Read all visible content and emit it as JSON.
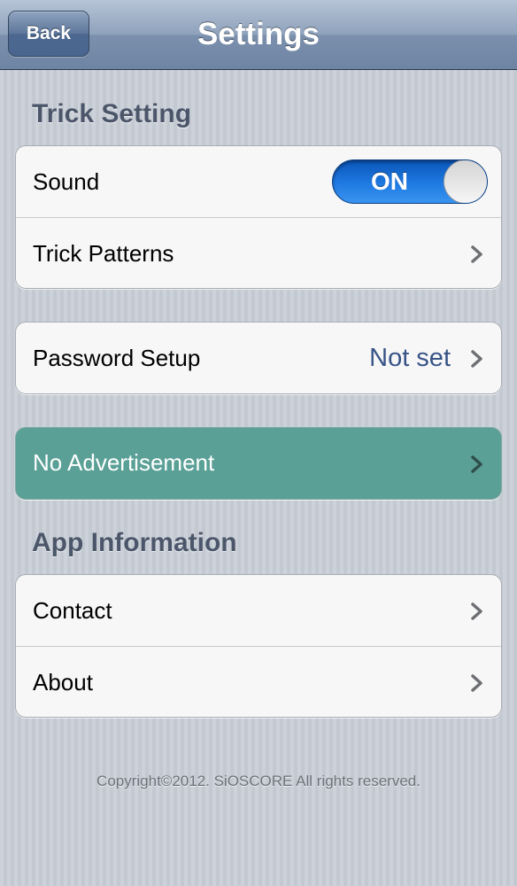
{
  "navbar": {
    "back_label": "Back",
    "title": "Settings"
  },
  "sections": {
    "trick": {
      "header": "Trick Setting",
      "sound": {
        "label": "Sound",
        "toggle_state": "ON"
      },
      "patterns": {
        "label": "Trick Patterns"
      }
    },
    "password": {
      "label": "Password Setup",
      "value": "Not set"
    },
    "ads": {
      "label": "No Advertisement"
    },
    "app_info": {
      "header": "App Information",
      "contact": {
        "label": "Contact"
      },
      "about": {
        "label": "About"
      }
    }
  },
  "footer": {
    "copyright": "Copyright©2012. SiOSCORE All rights reserved."
  },
  "colors": {
    "navbar": "#7b90ad",
    "toggle_on": "#1f7ae2",
    "ad_row": "#5aa096",
    "value_text": "#385487"
  },
  "icons": {
    "chevron": "chevron-right-icon"
  }
}
